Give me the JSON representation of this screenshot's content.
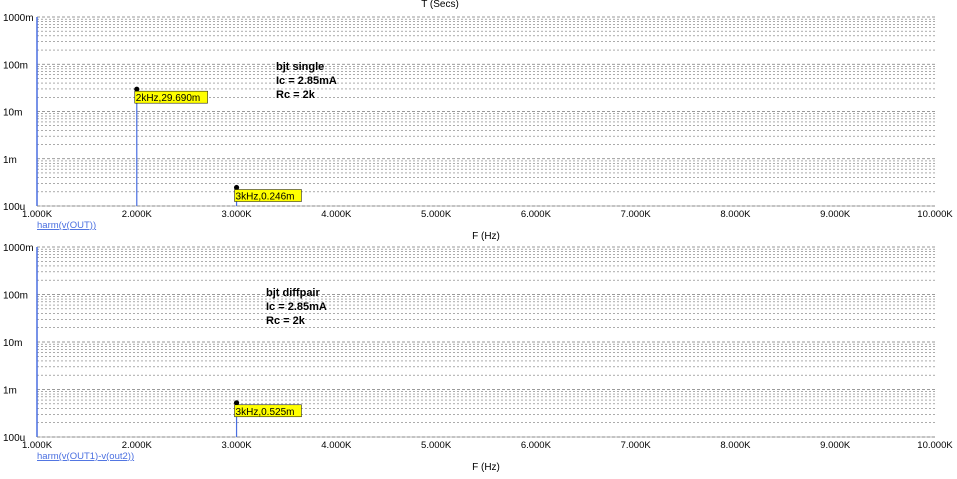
{
  "top_axis_label": "T (Secs)",
  "colors": {
    "background": "#ffffff",
    "frame": "#000000",
    "grid": "#7a7a7a",
    "trace": "#4a6fe0",
    "label_fill": "#ffff00",
    "text": "#000000"
  },
  "chart_data": [
    {
      "type": "bar",
      "trace_name": "harm(v(OUT))",
      "xlabel": "F (Hz)",
      "x_scale": "linear",
      "y_scale": "log",
      "xlim": [
        1000,
        10000
      ],
      "ylim": [
        0.0001,
        1
      ],
      "x_ticks": [
        "1.000K",
        "2.000K",
        "3.000K",
        "4.000K",
        "5.000K",
        "6.000K",
        "7.000K",
        "8.000K",
        "9.000K",
        "10.000K"
      ],
      "y_ticks": [
        "1000m",
        "100m",
        "10m",
        "1m",
        "100u"
      ],
      "grid": true,
      "annotation": [
        "bjt single",
        "Ic = 2.85mA",
        "Rc = 2k"
      ],
      "points": [
        {
          "x": 2000,
          "y": 0.02969,
          "label": "2kHz,29.690m"
        },
        {
          "x": 3000,
          "y": 0.000246,
          "label": "3kHz,0.246m"
        }
      ]
    },
    {
      "type": "bar",
      "trace_name": "harm(v(OUT1)-v(out2))",
      "xlabel": "F (Hz)",
      "x_scale": "linear",
      "y_scale": "log",
      "xlim": [
        1000,
        10000
      ],
      "ylim": [
        0.0001,
        1
      ],
      "x_ticks": [
        "1.000K",
        "2.000K",
        "3.000K",
        "4.000K",
        "5.000K",
        "6.000K",
        "7.000K",
        "8.000K",
        "9.000K",
        "10.000K"
      ],
      "y_ticks": [
        "1000m",
        "100m",
        "10m",
        "1m",
        "100u"
      ],
      "grid": true,
      "annotation": [
        "bjt diffpair",
        "Ic = 2.85mA",
        "Rc = 2k"
      ],
      "points": [
        {
          "x": 3000,
          "y": 0.000525,
          "label": "3kHz,0.525m"
        }
      ]
    }
  ]
}
